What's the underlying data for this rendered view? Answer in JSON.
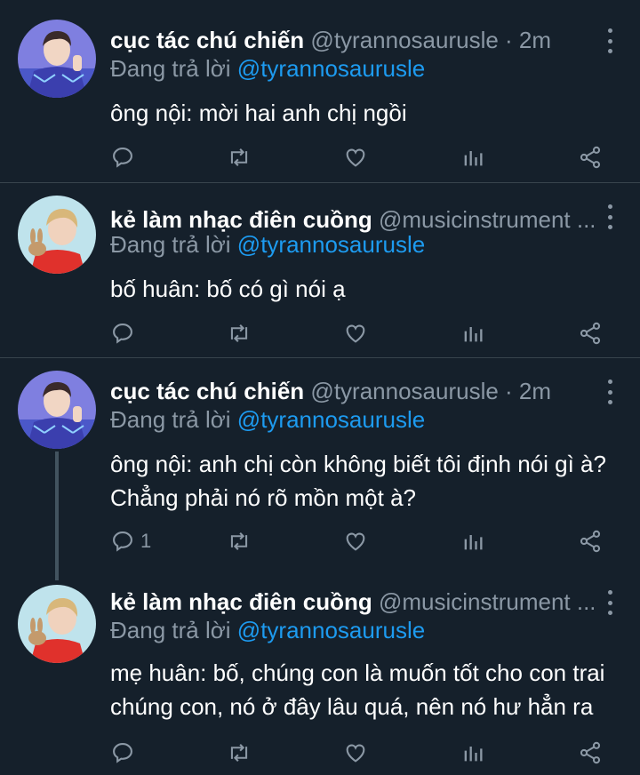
{
  "tweets": [
    {
      "name": "cục tác chú chiến",
      "handle": "@tyrannosaurusle · 2m",
      "reply_label": "Đang trả lời",
      "reply_to": "@tyrannosaurusle",
      "text_lines": [
        "ông nội: mời hai anh chị ngồi"
      ],
      "reply_count": ""
    },
    {
      "name": "kẻ làm nhạc điên cuồng",
      "handle": "@musicinstrument ...",
      "reply_label": "Đang trả lời",
      "reply_to": "@tyrannosaurusle",
      "text_lines": [
        "bố huân: bố có gì nói ạ"
      ],
      "reply_count": ""
    },
    {
      "name": "cục tác chú chiến",
      "handle": "@tyrannosaurusle · 2m",
      "reply_label": "Đang trả lời",
      "reply_to": "@tyrannosaurusle",
      "text_lines": [
        "ông nội: anh chị còn không biết tôi định nói gì à?",
        "Chẳng phải nó rõ mồn một à?"
      ],
      "reply_count": "1"
    },
    {
      "name": "kẻ làm nhạc điên cuồng",
      "handle": "@musicinstrument ...",
      "reply_label": "Đang trả lời",
      "reply_to": "@tyrannosaurusle",
      "text_lines": [
        "mẹ huân: bố, chúng con là muốn tốt cho con trai",
        "chúng con, nó ở đây lâu quá, nên nó hư hẳn ra"
      ],
      "reply_count": ""
    }
  ],
  "icons": {
    "reply": "reply-icon",
    "retweet": "retweet-icon",
    "like": "heart-icon",
    "analytics": "analytics-icon",
    "share": "share-icon",
    "more": "more-vertical-icon"
  },
  "colors": {
    "background": "#15202b",
    "divider": "#38444d",
    "name": "#ffffff",
    "muted": "#8b98a5",
    "mention": "#1d9bf0"
  }
}
